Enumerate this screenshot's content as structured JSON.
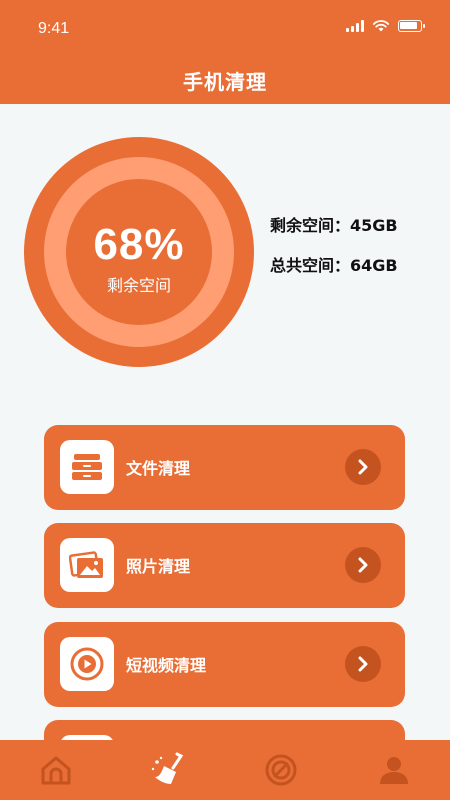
{
  "status_bar": {
    "time": "9:41"
  },
  "header": {
    "title": "手机清理"
  },
  "gauge": {
    "percent_text": "68%",
    "percent_value": 68,
    "label": "剩余空间"
  },
  "storage": {
    "free": "剩余空间：45GB",
    "total": "总共空间：64GB"
  },
  "menu": {
    "items": [
      {
        "label": "文件清理",
        "icon": "drawer-icon"
      },
      {
        "label": "照片清理",
        "icon": "photo-icon"
      },
      {
        "label": "短视频清理",
        "icon": "video-icon"
      }
    ]
  },
  "bottom_nav": {
    "items": [
      {
        "icon": "home-icon"
      },
      {
        "icon": "broom-icon"
      },
      {
        "icon": "speed-icon"
      },
      {
        "icon": "user-icon"
      }
    ]
  },
  "colors": {
    "accent": "#e96e35",
    "accent_dark": "#c4531f",
    "ring_light": "#ff9e72"
  }
}
